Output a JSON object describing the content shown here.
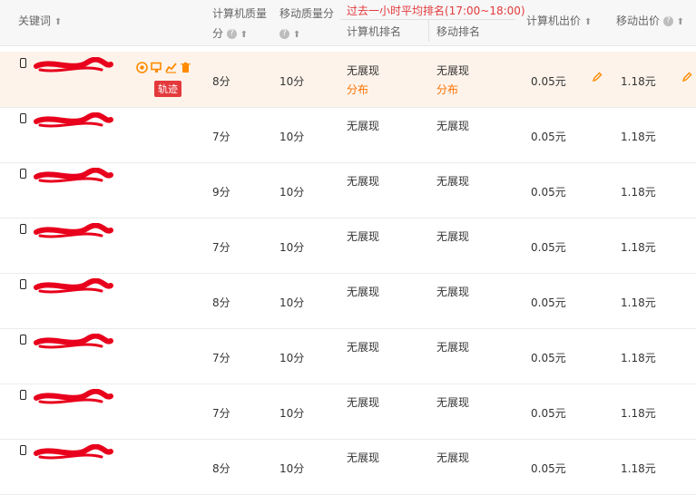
{
  "header": {
    "keyword": "关键词",
    "pc_quality_line1": "计算机质量",
    "pc_quality_line2": "分",
    "mobile_quality": "移动质量分",
    "rank_group": "过去一小时平均排名(17:00~18:00)",
    "pc_rank": "计算机排名",
    "mobile_rank": "移动排名",
    "pc_bid": "计算机出价",
    "mobile_bid": "移动出价",
    "sort_up_glyph": "⬆",
    "help_glyph": "?"
  },
  "first_row_extras": {
    "distribution_label": "分布",
    "track_label": "轨迹",
    "action_icons": [
      "target-icon",
      "monitor-icon",
      "chart-icon",
      "delete-icon"
    ]
  },
  "rows": [
    {
      "pc_score": "8分",
      "mobile_score": "10分",
      "pc_rank": "无展现",
      "mobile_rank": "无展现",
      "pc_bid": "0.05元",
      "mobile_bid": "1.18元"
    },
    {
      "pc_score": "7分",
      "mobile_score": "10分",
      "pc_rank": "无展现",
      "mobile_rank": "无展现",
      "pc_bid": "0.05元",
      "mobile_bid": "1.18元"
    },
    {
      "pc_score": "9分",
      "mobile_score": "10分",
      "pc_rank": "无展现",
      "mobile_rank": "无展现",
      "pc_bid": "0.05元",
      "mobile_bid": "1.18元"
    },
    {
      "pc_score": "7分",
      "mobile_score": "10分",
      "pc_rank": "无展现",
      "mobile_rank": "无展现",
      "pc_bid": "0.05元",
      "mobile_bid": "1.18元"
    },
    {
      "pc_score": "8分",
      "mobile_score": "10分",
      "pc_rank": "无展现",
      "mobile_rank": "无展现",
      "pc_bid": "0.05元",
      "mobile_bid": "1.18元"
    },
    {
      "pc_score": "7分",
      "mobile_score": "10分",
      "pc_rank": "无展现",
      "mobile_rank": "无展现",
      "pc_bid": "0.05元",
      "mobile_bid": "1.18元"
    },
    {
      "pc_score": "7分",
      "mobile_score": "10分",
      "pc_rank": "无展现",
      "mobile_rank": "无展现",
      "pc_bid": "0.05元",
      "mobile_bid": "1.18元"
    },
    {
      "pc_score": "8分",
      "mobile_score": "10分",
      "pc_rank": "无展现",
      "mobile_rank": "无展现",
      "pc_bid": "0.05元",
      "mobile_bid": "1.18元"
    }
  ],
  "colors": {
    "accent_red": "#e4393c",
    "accent_orange": "#ff7200",
    "highlight_row": "#fdf3ea",
    "redaction": "#e8001c"
  }
}
